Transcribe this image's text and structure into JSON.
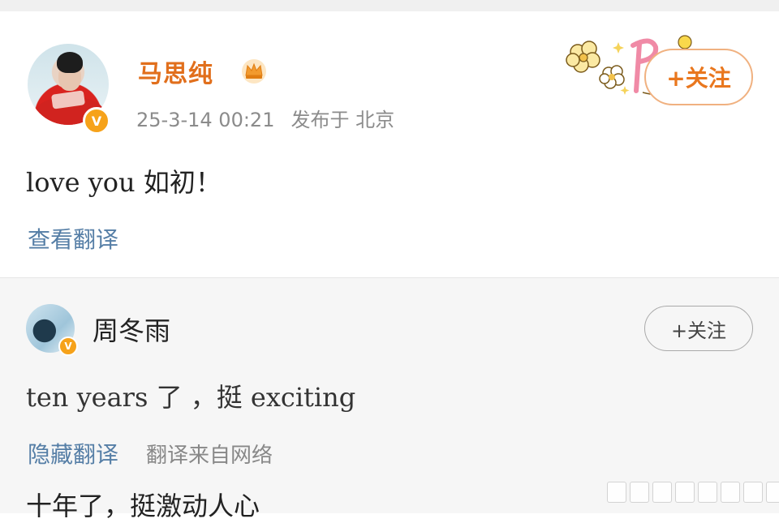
{
  "post": {
    "username": "马思纯",
    "timestamp": "25-3-14 00:21",
    "location": "发布于 北京",
    "follow_label": "+关注",
    "text": "love you 如初！",
    "translate_link": "查看翻译",
    "verified_badge": "V",
    "icons": [
      "crown-icon",
      "flower-sticker-icon",
      "verified-badge-icon"
    ]
  },
  "reply": {
    "username": "周冬雨",
    "follow_label": "+关注",
    "text": "ten years 了 ，挺 exciting",
    "hide_translation": "隐藏翻译",
    "translation_source": "翻译来自网络",
    "translated_text": "十年了，挺激动人心",
    "verified_badge": "V"
  },
  "colors": {
    "username_orange": "#e16f1c",
    "follow_orange": "#e9771e",
    "link_blue": "#557ea6",
    "meta_gray": "#8b8b8b",
    "badge_gold": "#f6a21a"
  }
}
